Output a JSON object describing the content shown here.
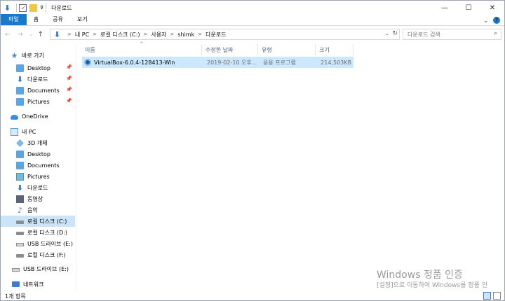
{
  "window": {
    "title": "다운로드",
    "controls": {
      "minimize": "—",
      "maximize": "☐",
      "close": "✕"
    }
  },
  "ribbon": {
    "tabs": [
      "파일",
      "홈",
      "공유",
      "보기"
    ],
    "expand_glyph": "⌄",
    "help_glyph": "?"
  },
  "nav": {
    "back": "←",
    "forward": "→",
    "recent": "⌄",
    "up": "↑"
  },
  "address": {
    "crumbs": [
      "내 PC",
      "로컬 디스크 (C:)",
      "사용자",
      "shimk",
      "다운로드"
    ],
    "separator": ">",
    "dropdown_glyph": "⌄",
    "refresh_glyph": "↻"
  },
  "search": {
    "placeholder": "다운로드 검색",
    "icon_glyph": "⌕"
  },
  "sidebar": {
    "items": [
      {
        "label": "바로 가기",
        "icon": "star-icon"
      },
      {
        "label": "Desktop",
        "icon": "folder-icon",
        "pinned": true
      },
      {
        "label": "다운로드",
        "icon": "download-icon",
        "pinned": true
      },
      {
        "label": "Documents",
        "icon": "folder-icon",
        "pinned": true
      },
      {
        "label": "Pictures",
        "icon": "folder-icon",
        "pinned": true
      },
      {
        "label": "OneDrive",
        "icon": "cloud-icon"
      },
      {
        "label": "내 PC",
        "icon": "computer-icon"
      },
      {
        "label": "3D 개체",
        "icon": "cube-icon"
      },
      {
        "label": "Desktop",
        "icon": "folder-icon"
      },
      {
        "label": "Documents",
        "icon": "folder-icon"
      },
      {
        "label": "Pictures",
        "icon": "pictures-icon"
      },
      {
        "label": "다운로드",
        "icon": "download-icon"
      },
      {
        "label": "동영상",
        "icon": "video-icon"
      },
      {
        "label": "음악",
        "icon": "music-icon"
      },
      {
        "label": "로컬 디스크 (C:)",
        "icon": "drive-icon",
        "selected": true
      },
      {
        "label": "로컬 디스크 (D:)",
        "icon": "drive-icon"
      },
      {
        "label": "USB 드라이브 (E:)",
        "icon": "usb-drive-icon"
      },
      {
        "label": "로컬 디스크 (F:)",
        "icon": "drive-icon"
      },
      {
        "label": "USB 드라이브 (E:)",
        "icon": "usb-drive-icon"
      },
      {
        "label": "네트워크",
        "icon": "network-icon"
      }
    ],
    "pin_glyph": "📌"
  },
  "columns": [
    "이름",
    "수정한 날짜",
    "유형",
    "크기"
  ],
  "sort_indicator": "^",
  "files": [
    {
      "name": "VirtualBox-6.0.4-128413-Win",
      "modified": "2019-02-10 오후...",
      "type": "응용 프로그램",
      "size": "214,503KB"
    }
  ],
  "status": {
    "text": "1개 항목"
  },
  "watermark": {
    "line1": "Windows 정품 인증",
    "line2": "[설정]으로 이동하여 Windows를 정품 인"
  },
  "colors": {
    "accent": "#1979ca",
    "selection": "#cce8ff",
    "header_text": "#4c607a"
  }
}
